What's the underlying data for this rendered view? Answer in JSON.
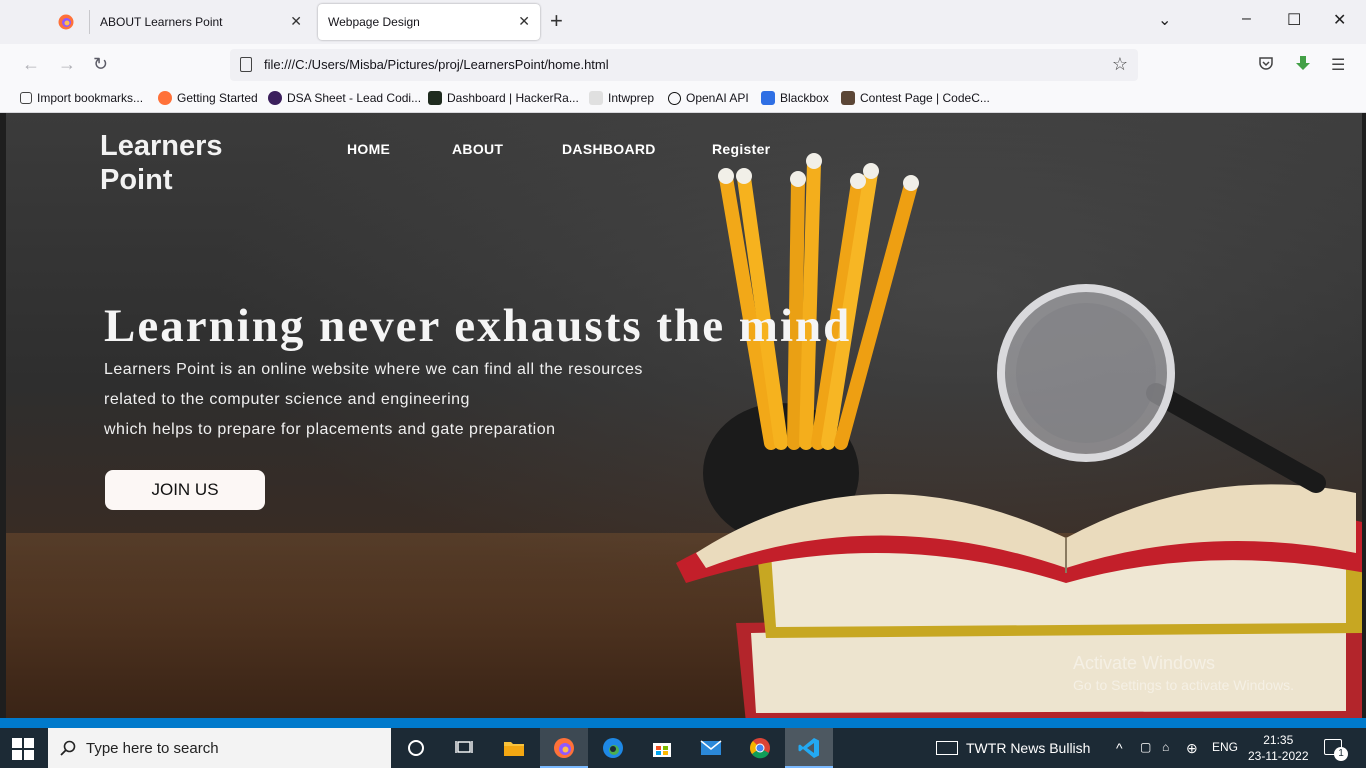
{
  "browser": {
    "tabs": [
      {
        "label": "ABOUT Learners Point",
        "active": false
      },
      {
        "label": "Webpage Design",
        "active": true
      }
    ],
    "new_tab": "+",
    "close_glyph": "✕",
    "url": "file:///C:/Users/Misba/Pictures/proj/LearnersPoint/home.html",
    "bookmarks": [
      {
        "label": "Import bookmarks...",
        "icon": "import-icon",
        "color": "#444444"
      },
      {
        "label": "Getting Started",
        "icon": "firefox-icon",
        "color": "#ff7139"
      },
      {
        "label": "DSA Sheet - Lead Codi...",
        "icon": "leadcoding-icon",
        "color": "#3b1f5c"
      },
      {
        "label": "Dashboard | HackerRa...",
        "icon": "hackerrank-icon",
        "color": "#1f2b1f"
      },
      {
        "label": "Intwprep",
        "icon": "intwprep-icon",
        "color": "#888888"
      },
      {
        "label": "OpenAI API",
        "icon": "openai-icon",
        "color": "#111111"
      },
      {
        "label": "Blackbox",
        "icon": "blackbox-icon",
        "color": "#2f6fe4"
      },
      {
        "label": "Contest Page | CodeC...",
        "icon": "codechef-icon",
        "color": "#5b4636"
      }
    ]
  },
  "site": {
    "brand": "Learners Point",
    "nav": [
      "HOME",
      "ABOUT",
      "DASHBOARD",
      "Register"
    ],
    "headline": "Learning never exhausts the mind",
    "description": [
      "Learners Point is an online website where we can find all the resources",
      "related to the computer science and engineering",
      "which helps to prepare for placements and gate preparation"
    ],
    "cta": "JOIN US"
  },
  "watermark": {
    "line1": "Activate Windows",
    "line2": "Go to Settings to activate Windows."
  },
  "taskbar": {
    "search_placeholder": "Type here to search",
    "news": "TWTR  News Bullish",
    "language": "ENG",
    "time": "21:35",
    "date": "23-11-2022",
    "notifications": "1"
  }
}
